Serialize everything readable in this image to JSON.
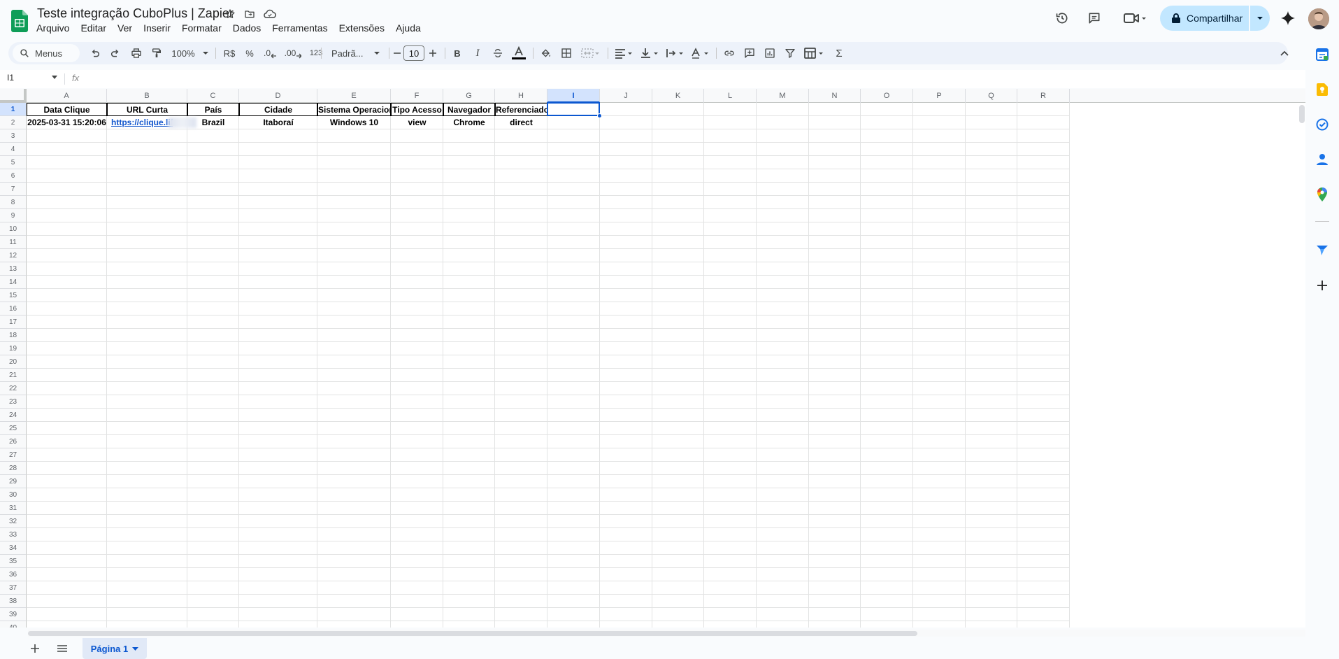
{
  "document": {
    "title": "Teste integração CuboPlus | Zapier"
  },
  "menu": [
    "Arquivo",
    "Editar",
    "Ver",
    "Inserir",
    "Formatar",
    "Dados",
    "Ferramentas",
    "Extensões",
    "Ajuda"
  ],
  "header": {
    "share_label": "Compartilhar",
    "icons": [
      "history-icon",
      "comment-icon",
      "meet-icon",
      "gemini-icon"
    ]
  },
  "toolbar": {
    "search_label": "Menus",
    "zoom": "100%",
    "currency": "R$",
    "percent": "%",
    "decrease_decimal": ".0",
    "increase_decimal": ".00",
    "number_format": "123",
    "font_name": "Padrã...",
    "font_size": "10",
    "bold": "B",
    "italic": "I",
    "sum": "Σ"
  },
  "formula_bar": {
    "cell_ref": "I1",
    "fx": "fx",
    "content": ""
  },
  "grid": {
    "columns": [
      "A",
      "B",
      "C",
      "D",
      "E",
      "F",
      "G",
      "H",
      "I",
      "J",
      "K",
      "L",
      "M",
      "N",
      "O",
      "P",
      "Q",
      "R"
    ],
    "selected_column": "I",
    "selected_row": 1,
    "row_count": 40,
    "header_row": [
      "Data Clique",
      "URL Curta",
      "País",
      "Cidade",
      "Sistema Operacional",
      "Tipo Acesso",
      "Navegador",
      "Referenciador"
    ],
    "data_row": [
      "2025-03-31 15:20:06",
      "https://clique.li/",
      "Brazil",
      "Itaboraí",
      "Windows 10",
      "view",
      "Chrome",
      "direct"
    ]
  },
  "sheets": {
    "active": "Página 1"
  },
  "colors": {
    "accent": "#0b57d0",
    "share_bg": "#c2e7ff",
    "link": "#1155cc",
    "sheets_green": "#0f9d58"
  }
}
